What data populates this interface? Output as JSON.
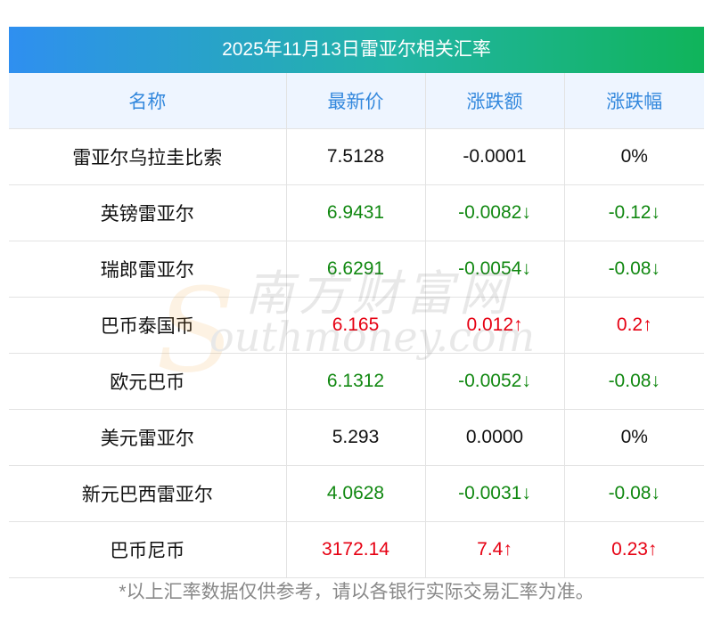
{
  "title": "2025年11月13日雷亚尔相关汇率",
  "headers": [
    "名称",
    "最新价",
    "涨跌额",
    "涨跌幅"
  ],
  "rows": [
    {
      "name": "雷亚尔乌拉圭比索",
      "price": "7.5128",
      "change": "-0.0001",
      "pct": "0%",
      "trend": "flat"
    },
    {
      "name": "英镑雷亚尔",
      "price": "6.9431",
      "change": "-0.0082↓",
      "pct": "-0.12↓",
      "trend": "down"
    },
    {
      "name": "瑞郎雷亚尔",
      "price": "6.6291",
      "change": "-0.0054↓",
      "pct": "-0.08↓",
      "trend": "down"
    },
    {
      "name": "巴币泰国币",
      "price": "6.165",
      "change": "0.012↑",
      "pct": "0.2↑",
      "trend": "up"
    },
    {
      "name": "欧元巴币",
      "price": "6.1312",
      "change": "-0.0052↓",
      "pct": "-0.08↓",
      "trend": "down"
    },
    {
      "name": "美元雷亚尔",
      "price": "5.293",
      "change": "0.0000",
      "pct": "0%",
      "trend": "flat"
    },
    {
      "name": "新元巴西雷亚尔",
      "price": "4.0628",
      "change": "-0.0031↓",
      "pct": "-0.08↓",
      "trend": "down"
    },
    {
      "name": "巴币尼币",
      "price": "3172.14",
      "change": "7.4↑",
      "pct": "0.23↑",
      "trend": "up"
    }
  ],
  "watermark": {
    "cn": "南方财富网",
    "en": "outhmoney.com",
    "s": "S"
  },
  "footnote": "*以上汇率数据仅供参考，请以各银行实际交易汇率为准。",
  "colors": {
    "up": "#e60012",
    "down": "#118811",
    "header_text": "#3388dd",
    "header_bg": "#eef5ff"
  }
}
